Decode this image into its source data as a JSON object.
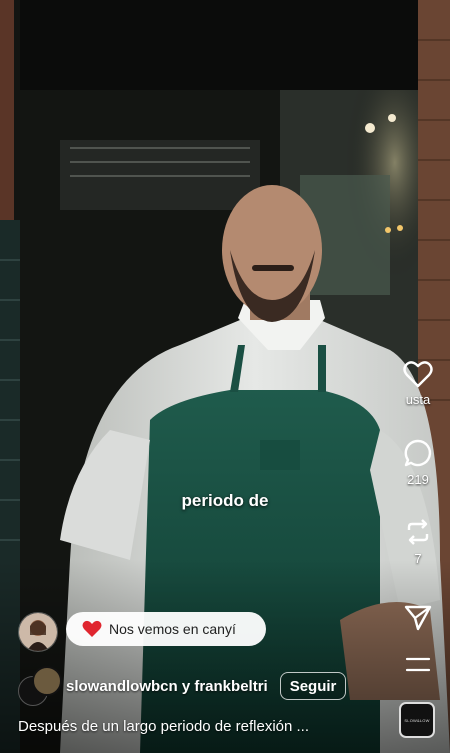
{
  "overlay_caption": "periodo de",
  "actions": {
    "like_label": "usta",
    "comment_count": "219",
    "repost_count": "7"
  },
  "note": {
    "text": "Nos vemos en canyí"
  },
  "author": {
    "names": "slowandlowbcn y frankbeltri",
    "follow_label": "Seguir"
  },
  "description": "Después de un largo periodo de reflexión ...",
  "audio": {
    "label": "SLOW&LOW"
  },
  "icons": {
    "like": "heart-icon",
    "comment": "comment-icon",
    "repost": "repost-icon",
    "share": "send-icon",
    "more": "more-icon",
    "note_emoji": "red-heart-emoji"
  }
}
